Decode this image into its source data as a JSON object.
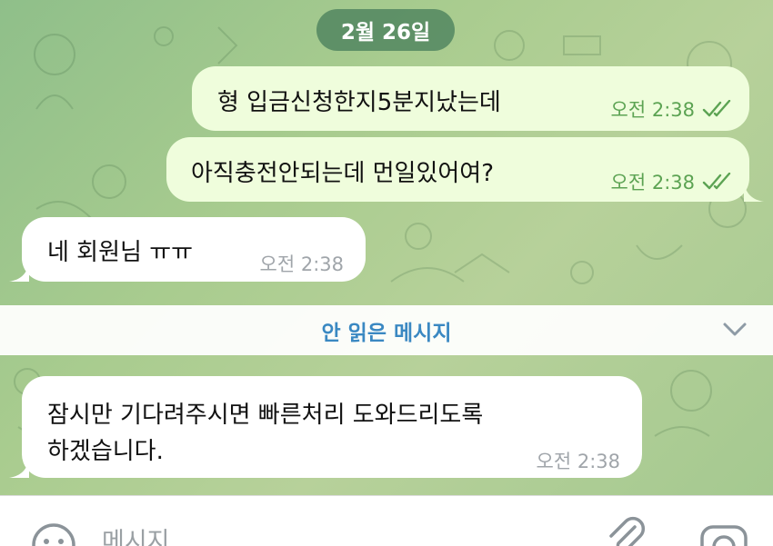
{
  "chat": {
    "date_label": "2월 26일",
    "messages": [
      {
        "direction": "out",
        "text": "형 입금신청한지5분지났는데",
        "time": "오전 2:38",
        "status": "read"
      },
      {
        "direction": "out",
        "text": "아직충전안되는데 먼일있어여?",
        "time": "오전 2:38",
        "status": "read"
      },
      {
        "direction": "in",
        "text": "네 회원님 ㅠㅠ",
        "time": "오전 2:38"
      },
      {
        "direction": "in",
        "text_lines": [
          "잠시만 기다려주시면 빠른처리 도와드리도록",
          "하겠습니다."
        ],
        "time": "오전 2:38"
      }
    ],
    "unread_divider": "안 읽은 메시지"
  },
  "composer": {
    "placeholder": "메시지"
  },
  "icons": {
    "emoji": "emoji-icon",
    "attach": "paperclip-icon",
    "camera": "camera-icon",
    "read_receipt": "double-check-icon",
    "chevron": "chevron-down-icon"
  },
  "colors": {
    "outgoing_bubble": "#effddc",
    "incoming_bubble": "#ffffff",
    "read_check": "#5ca353",
    "unread_text": "#3a88c2",
    "date_pill": "#4a805c"
  }
}
